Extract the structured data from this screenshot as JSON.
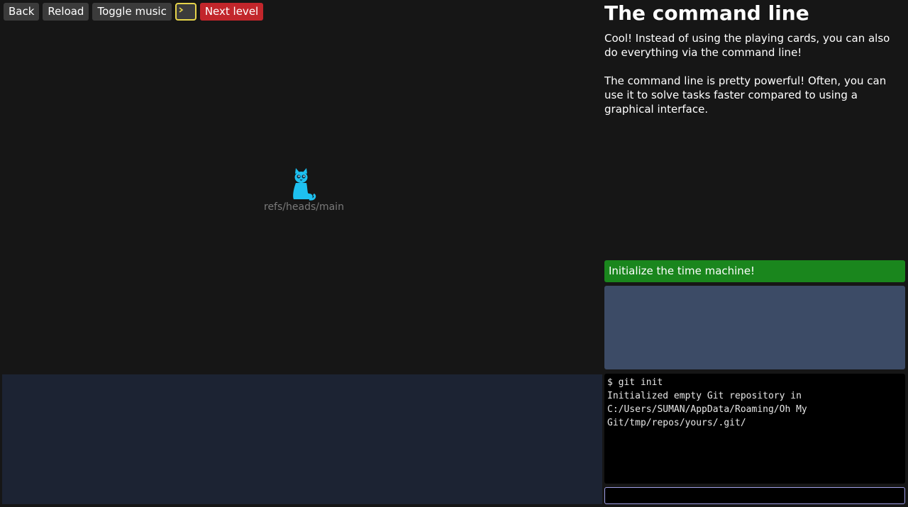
{
  "toolbar": {
    "back_label": "Back",
    "reload_label": "Reload",
    "toggle_music_label": "Toggle music",
    "terminal_icon": "terminal-icon",
    "next_level_label": "Next level"
  },
  "graph": {
    "ref_label": "refs/heads/main",
    "ref_icon": "cat-icon"
  },
  "level": {
    "title": "The command line",
    "paragraphs": [
      "Cool! Instead of using the playing cards, you can also do everything via the command line!",
      "The command line is pretty powerful! Often, you can use it to solve tasks faster compared to using a graphical interface."
    ],
    "goal": "Initialize the time machine!"
  },
  "terminal": {
    "lines": [
      "$ git init",
      "Initialized empty Git repository in C:/Users/SUMAN/AppData/Roaming/Oh My Git/tmp/repos/yours/.git/"
    ],
    "input_value": "",
    "input_placeholder": ""
  },
  "colors": {
    "background": "#161616",
    "button": "#3b3b3b",
    "next_level": "#c2262b",
    "goal": "#1a861d",
    "goal_box": "#3c4b66",
    "cards_area": "#1c2333",
    "cat": "#1ec0f0"
  }
}
